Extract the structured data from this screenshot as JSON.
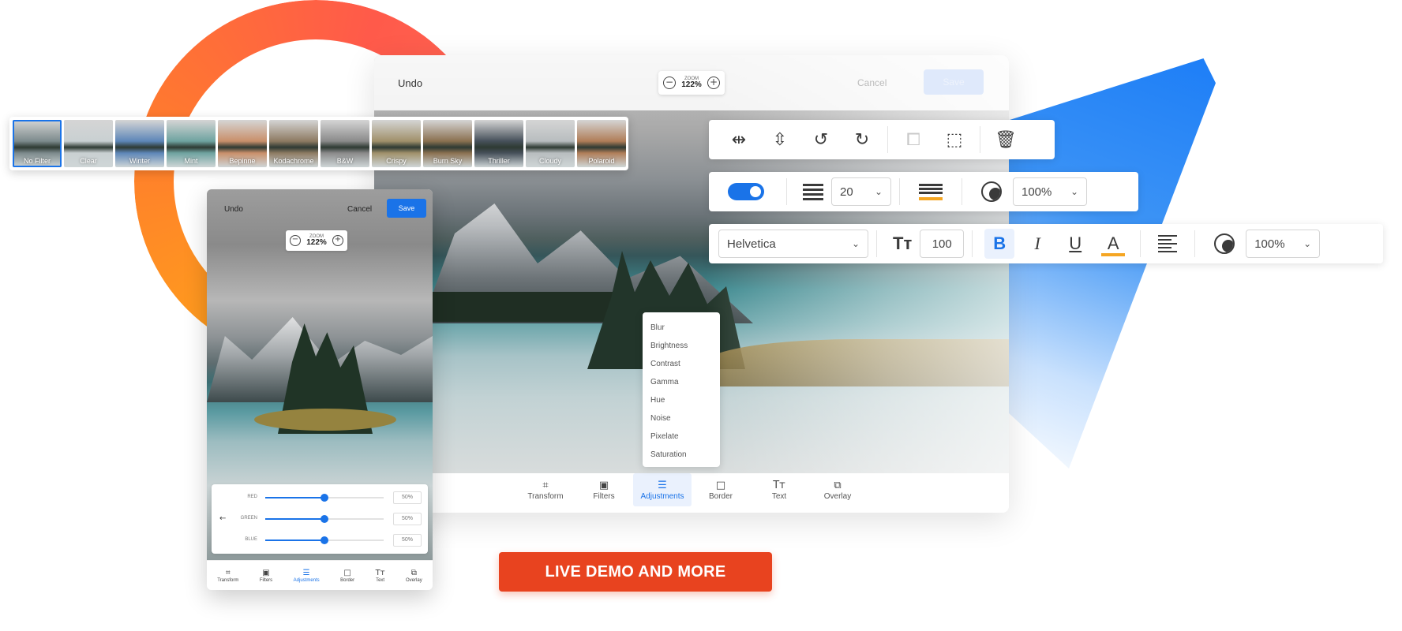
{
  "editor_lg": {
    "undo": "Undo",
    "zoom_label": "ZOOM",
    "zoom_value": "122%",
    "cancel": "Cancel",
    "save": "Save",
    "adjust_menu": [
      "Blur",
      "Brightness",
      "Contrast",
      "Gamma",
      "Hue",
      "Noise",
      "Pixelate",
      "Saturation"
    ],
    "toolbar": [
      "Transform",
      "Filters",
      "Adjustments",
      "Border",
      "Text",
      "Overlay"
    ],
    "active_tool": "Adjustments"
  },
  "filters": {
    "items": [
      "No Filter",
      "Clear",
      "Winter",
      "Mint",
      "Bepinne",
      "Kodachrome",
      "B&W",
      "Crispy",
      "Burn Sky",
      "Thriller",
      "Cloudy",
      "Polaroid"
    ],
    "tints": [
      "#7c8a8c",
      "#c9d0d2",
      "#5d86b8",
      "#6ea3a0",
      "#c98f6a",
      "#8d7a62",
      "#8a8a8a",
      "#a0906a",
      "#8a7050",
      "#46505a",
      "#b8bdbf",
      "#b07d58"
    ],
    "selected": "No Filter"
  },
  "editor_sm": {
    "undo": "Undo",
    "cancel": "Cancel",
    "save": "Save",
    "zoom_label": "ZOOM",
    "zoom_value": "122%",
    "rgb": [
      {
        "label": "RED",
        "value": "50%",
        "level": 0.5
      },
      {
        "label": "GREEN",
        "value": "50%",
        "level": 0.5
      },
      {
        "label": "BLUE",
        "value": "50%",
        "level": 0.5
      }
    ],
    "toolbar": [
      "Transform",
      "Filters",
      "Adjustments",
      "Border",
      "Text",
      "Overlay"
    ],
    "active_tool": "Adjustments"
  },
  "stroke_bar": {
    "line_width": "20",
    "opacity": "100%"
  },
  "text_bar": {
    "font": "Helvetica",
    "font_size": "100",
    "bold": "B",
    "italic": "I",
    "underline": "U",
    "color": "A",
    "opacity": "100%"
  },
  "cta": "LIVE DEMO AND MORE",
  "colors": {
    "accent": "#1a73e8",
    "cta": "#e8431f",
    "highlight": "#f5a623"
  }
}
